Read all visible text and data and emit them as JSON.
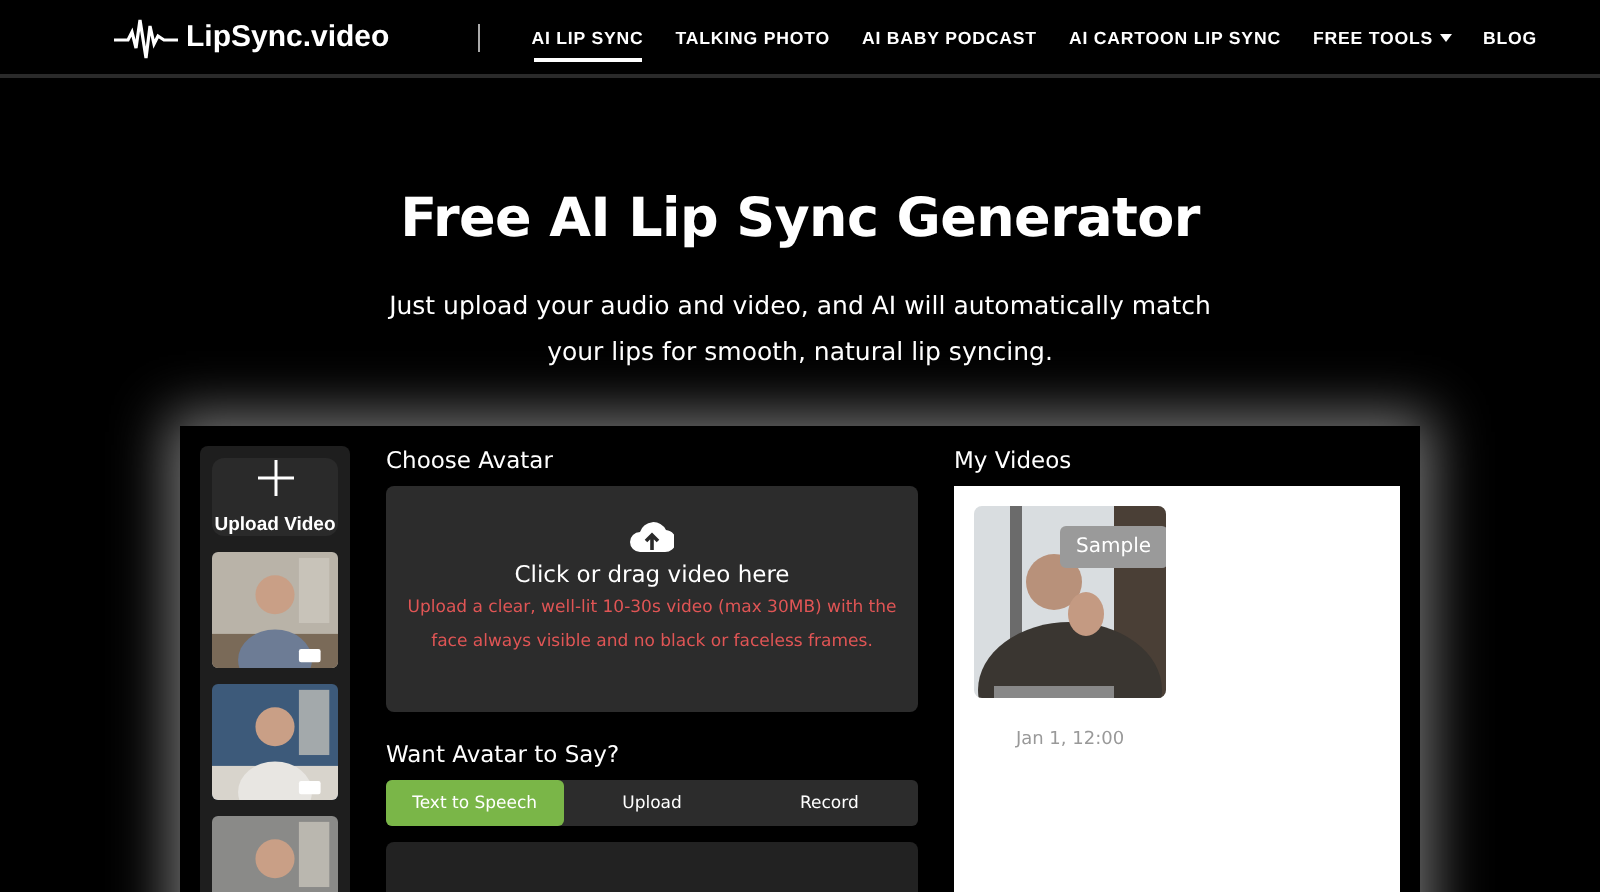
{
  "header": {
    "logo": "LipSync.video",
    "nav": [
      {
        "label": "AI LIP SYNC",
        "selected": true,
        "dropdown": false
      },
      {
        "label": "TALKING PHOTO",
        "selected": false,
        "dropdown": false
      },
      {
        "label": "AI BABY PODCAST",
        "selected": false,
        "dropdown": false
      },
      {
        "label": "AI CARTOON LIP SYNC",
        "selected": false,
        "dropdown": false
      },
      {
        "label": "FREE TOOLS",
        "selected": false,
        "dropdown": true
      },
      {
        "label": "BLOG",
        "selected": false,
        "dropdown": false
      }
    ]
  },
  "hero": {
    "title": "Free AI Lip Sync Generator",
    "subtitle": "Just upload your audio and video, and AI will automatically match your lips for smooth, natural lip syncing."
  },
  "sidebar": {
    "upload_label": "Upload Video"
  },
  "avatar_section": {
    "title": "Choose Avatar",
    "drop_title": "Click or drag video here",
    "drop_hint": "Upload a clear, well-lit 10-30s video (max 30MB) with the face always visible and no black or faceless frames."
  },
  "say_section": {
    "title": "Want Avatar to Say?",
    "tabs": [
      {
        "label": "Text to Speech",
        "selected": true
      },
      {
        "label": "Upload",
        "selected": false
      },
      {
        "label": "Record",
        "selected": false
      }
    ]
  },
  "my_videos": {
    "title": "My Videos",
    "items": [
      {
        "badge": "Sample",
        "date": "Jan 1, 12:00"
      }
    ]
  }
}
